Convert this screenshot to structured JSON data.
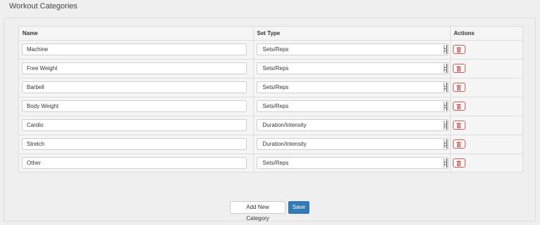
{
  "page": {
    "title": "Workout Categories"
  },
  "table": {
    "headers": {
      "name": "Name",
      "set_type": "Set Type",
      "actions": "Actions"
    },
    "rows": [
      {
        "name": "Machine",
        "set_type": "Sets/Reps"
      },
      {
        "name": "Free Weight",
        "set_type": "Sets/Reps"
      },
      {
        "name": "Barbell",
        "set_type": "Sets/Reps"
      },
      {
        "name": "Body Weight",
        "set_type": "Sets/Reps"
      },
      {
        "name": "Cardio",
        "set_type": "Duration/Intensity"
      },
      {
        "name": "Stretch",
        "set_type": "Duration/Intensity"
      },
      {
        "name": "Other",
        "set_type": "Sets/Reps"
      }
    ],
    "delete_icon": "trash-icon"
  },
  "buttons": {
    "add_label": "Add New Category",
    "save_label": "Save"
  },
  "colors": {
    "primary": "#337ab7",
    "danger": "#d9534f",
    "background": "#efefef"
  }
}
